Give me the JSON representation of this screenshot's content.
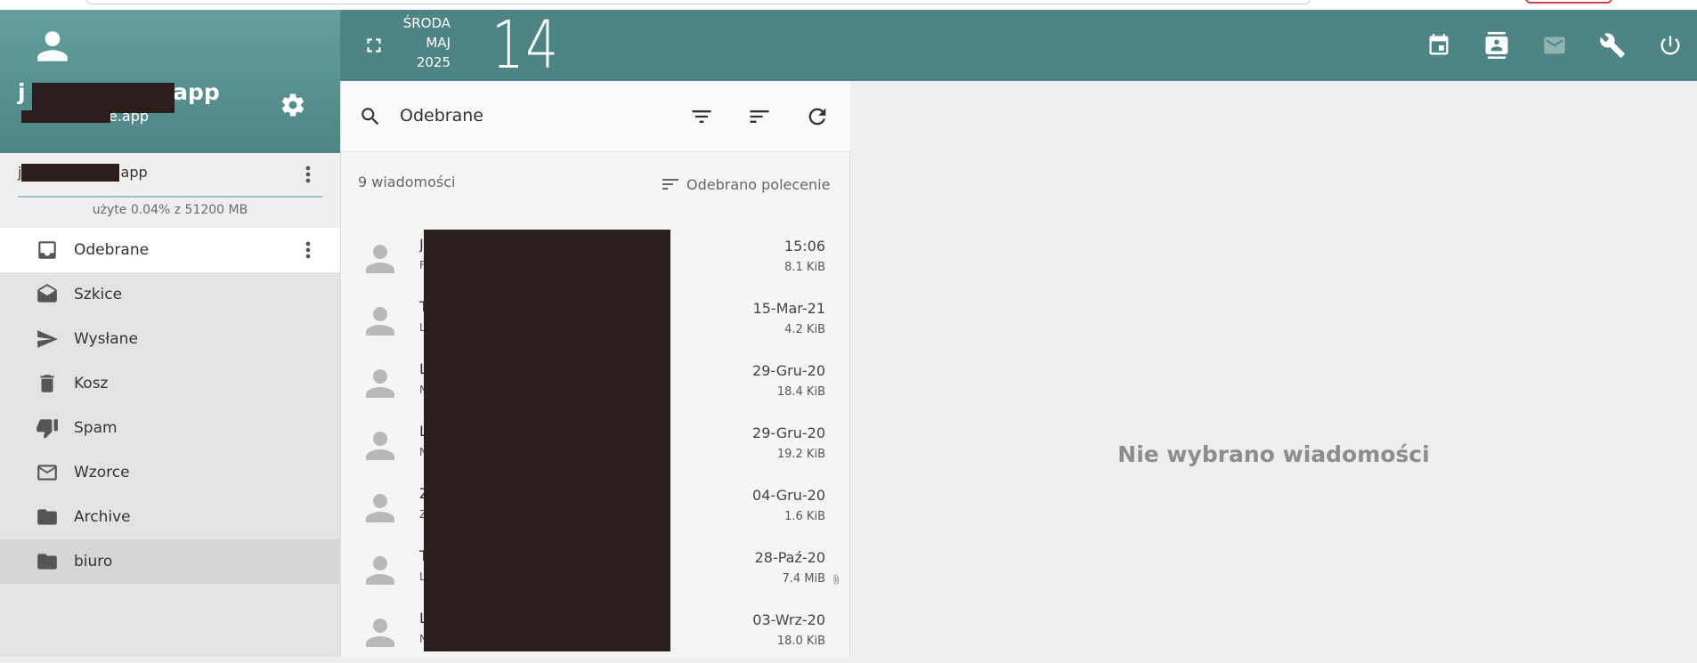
{
  "header": {
    "weekday": "ŚRODA",
    "month": "MAJ",
    "year": "2025",
    "day": "14",
    "icons": [
      "fullscreen-icon",
      "calendar-icon",
      "contacts-icon",
      "mail-icon",
      "wrench-icon",
      "power-icon"
    ]
  },
  "account": {
    "name_prefix": "j",
    "name_suffix": ".app",
    "sub_suffix": "e.app",
    "email_prefix": "j",
    "email_suffix": ".app",
    "quota": "użyte 0.04% z 51200 MB"
  },
  "folders": [
    {
      "label": "Odebrane",
      "icon": "inbox-icon"
    },
    {
      "label": "Szkice",
      "icon": "drafts-icon"
    },
    {
      "label": "Wysłane",
      "icon": "send-icon"
    },
    {
      "label": "Kosz",
      "icon": "trash-icon"
    },
    {
      "label": "Spam",
      "icon": "thumb-down-icon"
    },
    {
      "label": "Wzorce",
      "icon": "envelope-icon"
    },
    {
      "label": "Archive",
      "icon": "folder-icon"
    },
    {
      "label": "biuro",
      "icon": "folder-icon"
    }
  ],
  "list": {
    "title": "Odebrane",
    "count": "9 wiadomości",
    "sort_label": "Odebrano polecenie",
    "messages": [
      {
        "from": "J",
        "subject": "F",
        "date": "15:06",
        "size": "8.1 KiB",
        "attachment": false
      },
      {
        "from": "T",
        "subject": "L",
        "date": "15-Mar-21",
        "size": "4.2 KiB",
        "attachment": false
      },
      {
        "from": "L",
        "subject": "N",
        "date": "29-Gru-20",
        "size": "18.4 KiB",
        "attachment": false
      },
      {
        "from": "L",
        "subject": "N",
        "date": "29-Gru-20",
        "size": "19.2 KiB",
        "attachment": false
      },
      {
        "from": "Z",
        "subject": "Z",
        "date": "04-Gru-20",
        "size": "1.6 KiB",
        "attachment": false
      },
      {
        "from": "T",
        "subject": "L",
        "date": "28-Paź-20",
        "size": "7.4 MiB",
        "attachment": true
      },
      {
        "from": "L",
        "subject": "N",
        "date": "03-Wrz-20",
        "size": "18.0 KiB",
        "attachment": false
      }
    ]
  },
  "pane": {
    "empty_text": "Nie wybrano wiadomości"
  }
}
